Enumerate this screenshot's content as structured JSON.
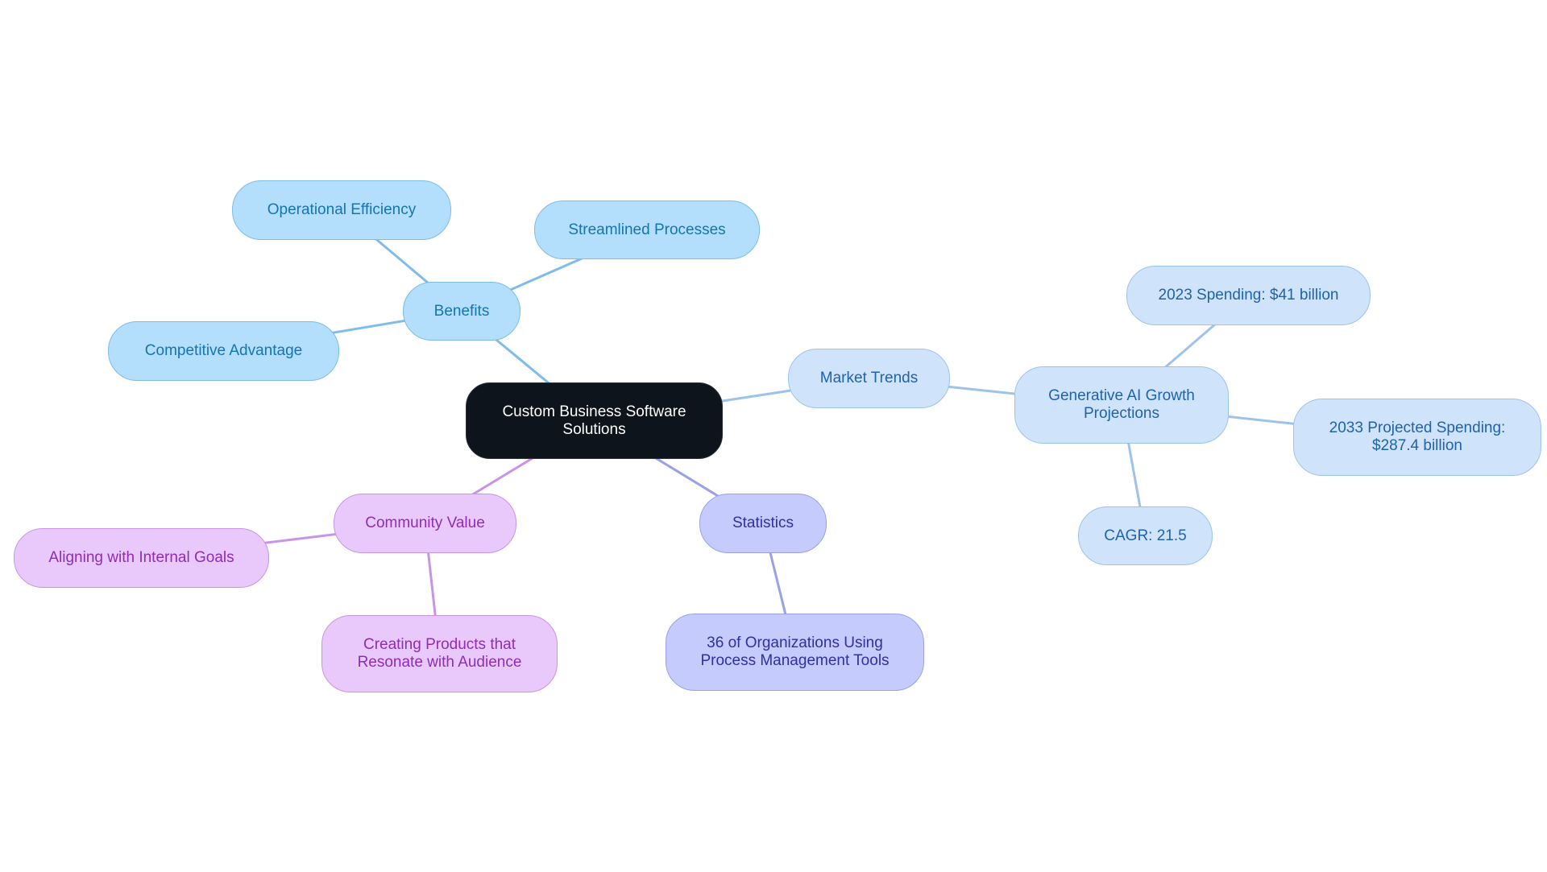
{
  "title": "Custom Business Software Solutions mind map",
  "colors": {
    "root": "#0d141b",
    "benefits_branch": "#7fbde8",
    "market_branch": "#9ec3ea",
    "community_branch": "#c994e6",
    "statistics_branch": "#9aa1e8"
  },
  "nodes": {
    "root": {
      "label_line1": "Custom Business Software",
      "label_line2": "Solutions"
    },
    "benefits": {
      "label": "Benefits"
    },
    "operational_efficiency": {
      "label": "Operational Efficiency"
    },
    "streamlined_processes": {
      "label": "Streamlined Processes"
    },
    "competitive_advantage": {
      "label": "Competitive Advantage"
    },
    "market_trends": {
      "label": "Market Trends"
    },
    "generative_ai": {
      "label_line1": "Generative AI Growth",
      "label_line2": "Projections"
    },
    "spending_2023": {
      "label": "2023 Spending: $41 billion"
    },
    "spending_2033": {
      "label_line1": "2033 Projected Spending:",
      "label_line2": "$287.4 billion"
    },
    "cagr": {
      "label": "CAGR: 21.5"
    },
    "community_value": {
      "label": "Community Value"
    },
    "aligning_goals": {
      "label": "Aligning with Internal Goals"
    },
    "creating_products": {
      "label_line1": "Creating Products that",
      "label_line2": "Resonate with Audience"
    },
    "statistics": {
      "label": "Statistics"
    },
    "organizations_36": {
      "label_line1": "36 of Organizations Using",
      "label_line2": "Process Management Tools"
    }
  },
  "edges": [
    {
      "from": "root",
      "to": "benefits",
      "color": "benefits_branch"
    },
    {
      "from": "benefits",
      "to": "operational_efficiency",
      "color": "benefits_branch"
    },
    {
      "from": "benefits",
      "to": "streamlined_processes",
      "color": "benefits_branch"
    },
    {
      "from": "benefits",
      "to": "competitive_advantage",
      "color": "benefits_branch"
    },
    {
      "from": "root",
      "to": "market_trends",
      "color": "market_branch"
    },
    {
      "from": "market_trends",
      "to": "generative_ai",
      "color": "market_branch"
    },
    {
      "from": "generative_ai",
      "to": "spending_2023",
      "color": "market_branch"
    },
    {
      "from": "generative_ai",
      "to": "spending_2033",
      "color": "market_branch"
    },
    {
      "from": "generative_ai",
      "to": "cagr",
      "color": "market_branch"
    },
    {
      "from": "root",
      "to": "community_value",
      "color": "community_branch"
    },
    {
      "from": "community_value",
      "to": "aligning_goals",
      "color": "community_branch"
    },
    {
      "from": "community_value",
      "to": "creating_products",
      "color": "community_branch"
    },
    {
      "from": "root",
      "to": "statistics",
      "color": "statistics_branch"
    },
    {
      "from": "statistics",
      "to": "organizations_36",
      "color": "statistics_branch"
    }
  ]
}
